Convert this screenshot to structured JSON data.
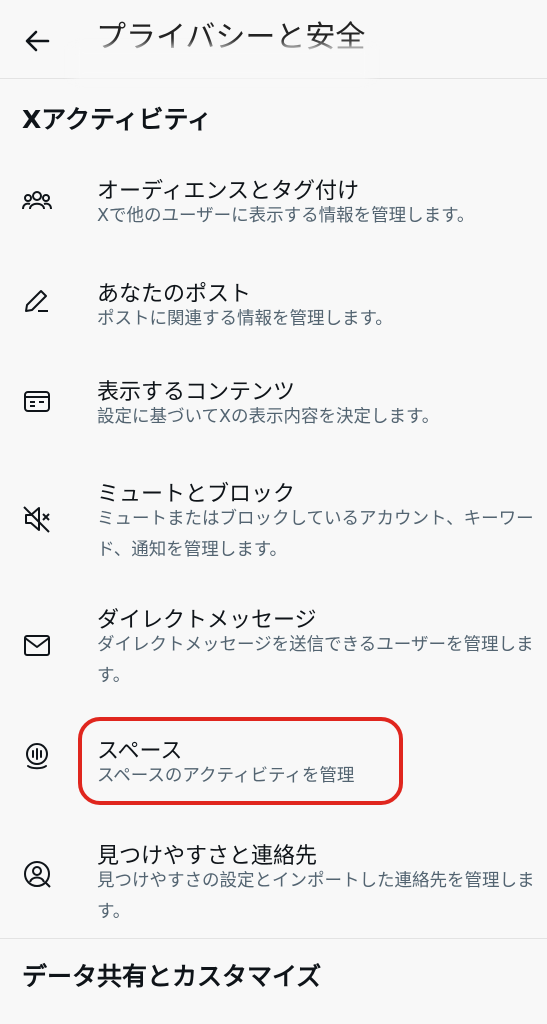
{
  "header": {
    "title": "プライバシーと安全"
  },
  "sections": [
    {
      "title": "Xアクティビティ"
    },
    {
      "title": "データ共有とカスタマイズ"
    }
  ],
  "items": [
    {
      "icon": "audience-icon",
      "title": "オーディエンスとタグ付け",
      "desc": "Xで他のユーザーに表示する情報を管理します。"
    },
    {
      "icon": "pencil-icon",
      "title": "あなたのポスト",
      "desc": "ポストに関連する情報を管理します。"
    },
    {
      "icon": "content-display-icon",
      "title": "表示するコンテンツ",
      "desc": "設定に基づいてXの表示内容を決定します。"
    },
    {
      "icon": "mute-speaker-icon",
      "title": "ミュートとブロック",
      "desc": "ミュートまたはブロックしているアカウント、キーワード、通知を管理します。"
    },
    {
      "icon": "envelope-icon",
      "title": "ダイレクトメッセージ",
      "desc": "ダイレクトメッセージを送信できるユーザーを管理します。"
    },
    {
      "icon": "spaces-icon",
      "title": "スペース",
      "desc": "スペースのアクティビティを管理"
    },
    {
      "icon": "discoverability-icon",
      "title": "見つけやすさと連絡先",
      "desc": "見つけやすさの設定とインポートした連絡先を管理します。"
    }
  ],
  "colors": {
    "highlight": "#e0261e",
    "secondary_text": "#536471"
  }
}
